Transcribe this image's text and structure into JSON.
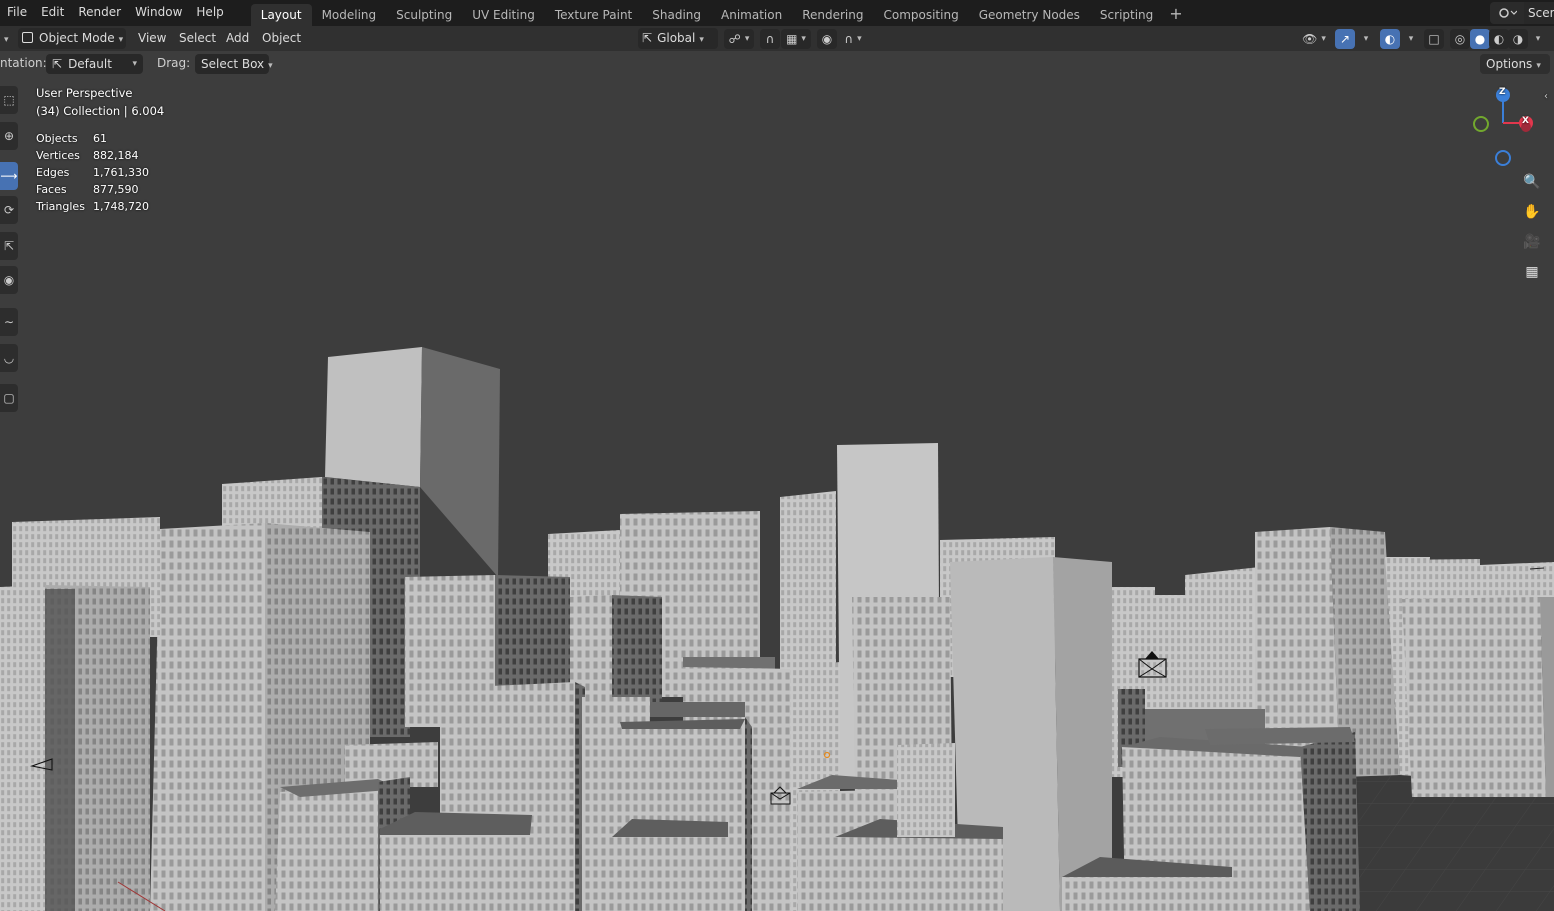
{
  "menubar": {
    "items": [
      "File",
      "Edit",
      "Render",
      "Window",
      "Help"
    ],
    "workspaces": [
      "Layout",
      "Modeling",
      "Sculpting",
      "UV Editing",
      "Texture Paint",
      "Shading",
      "Animation",
      "Rendering",
      "Compositing",
      "Geometry Nodes",
      "Scripting"
    ],
    "active_workspace": "Layout",
    "add_tab": "+",
    "scene_label": "Scer"
  },
  "header": {
    "mode": "Object Mode",
    "menus": [
      "View",
      "Select",
      "Add",
      "Object"
    ],
    "transform_orientation": "Global"
  },
  "toolsettings": {
    "orientation_label": "ntation:",
    "orientation_value": "Default",
    "drag_label": "Drag:",
    "drag_value": "Select Box",
    "options_label": "Options"
  },
  "viewport": {
    "view_name": "User Perspective",
    "collection_line": "(34) Collection | 6.004",
    "stats": [
      {
        "label": "Objects",
        "value": "61"
      },
      {
        "label": "Vertices",
        "value": "882,184"
      },
      {
        "label": "Edges",
        "value": "1,761,330"
      },
      {
        "label": "Faces",
        "value": "877,590"
      },
      {
        "label": "Triangles",
        "value": "1,748,720"
      }
    ],
    "gizmo_axes": {
      "z": "Z",
      "x": "X"
    },
    "colors": {
      "background": "#3d3d3d",
      "building_light": "#bcbcbc",
      "building_mid": "#a6a6a6",
      "building_dark": "#7a7a7a",
      "roof": "#6e6e6e",
      "axis_x": "#e2374d",
      "axis_y": "#72a82e",
      "axis_z": "#3b7fd8",
      "accent_blue": "#4772b3"
    }
  },
  "icons": {
    "left_tools": [
      "select-box-icon",
      "cursor-icon",
      "move-icon",
      "rotate-icon",
      "scale-icon",
      "transform-icon",
      "annotate-icon",
      "measure-icon",
      "add-cube-icon"
    ],
    "nav": [
      "zoom-icon",
      "pan-hand-icon",
      "camera-view-icon",
      "grid-view-icon"
    ]
  }
}
